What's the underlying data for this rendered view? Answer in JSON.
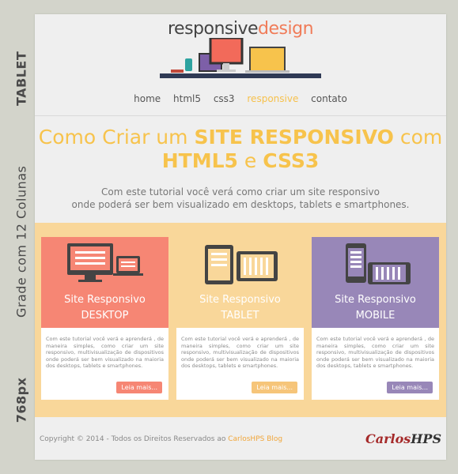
{
  "side": {
    "width_label": "768px",
    "grid_label": "Grade com 12 Colunas",
    "device_label": "TABLET"
  },
  "logo": {
    "part1": "responsive",
    "part2": "design"
  },
  "nav": {
    "items": [
      {
        "label": "home"
      },
      {
        "label": "html5"
      },
      {
        "label": "css3"
      },
      {
        "label": "responsive"
      },
      {
        "label": "contato"
      }
    ]
  },
  "hero": {
    "title_pre": "Como Criar um ",
    "title_bold1": "SITE RESPONSIVO",
    "title_mid": " com",
    "title_bold2": "HTML5",
    "title_e": " e ",
    "title_bold3": "CSS3",
    "subtitle_line1": "Com este tutorial você verá como criar um site responsivo",
    "subtitle_line2": "onde poderá ser bem visualizado em desktops, tablets e smartphones."
  },
  "cards": [
    {
      "title1": "Site Responsivo",
      "title2": "DESKTOP",
      "text": "Com este tutorial você verá e aprenderá , de maneira simples, como criar um site responsivo, multivisualização de dispositivos onde poderá ser bem visualizado na maioria dos desktops, tablets e smartphones.",
      "button": "Leia mais...",
      "color": "#f68674",
      "btn_color": "#f68674"
    },
    {
      "title1": "Site Responsivo",
      "title2": "TABLET",
      "text": "Com este tutorial você verá e aprenderá , de maneira simples, como criar um site responsivo, multivisualização de dispositivos onde poderá ser bem visualizado na maioria dos desktops, tablets e smartphones.",
      "button": "Leia mais...",
      "color": "#f9d79a",
      "btn_color": "#f6c57a"
    },
    {
      "title1": "Site Responsivo",
      "title2": "MOBILE",
      "text": "Com este tutorial você verá e aprenderá , de maneira simples, como criar um site responsivo, multivisualização de dispositivos onde poderá ser bem visualizado na maioria dos desktops, tablets e smartphones.",
      "button": "Leia mais...",
      "color": "#9887b8",
      "btn_color": "#9887b8"
    }
  ],
  "footer": {
    "copy_text": "Copyright © 2014 - Todos os Direitos Reservados ao ",
    "copy_link": "CarlosHPS Blog",
    "brand_c": "Carlos",
    "brand_h": "HPS"
  }
}
